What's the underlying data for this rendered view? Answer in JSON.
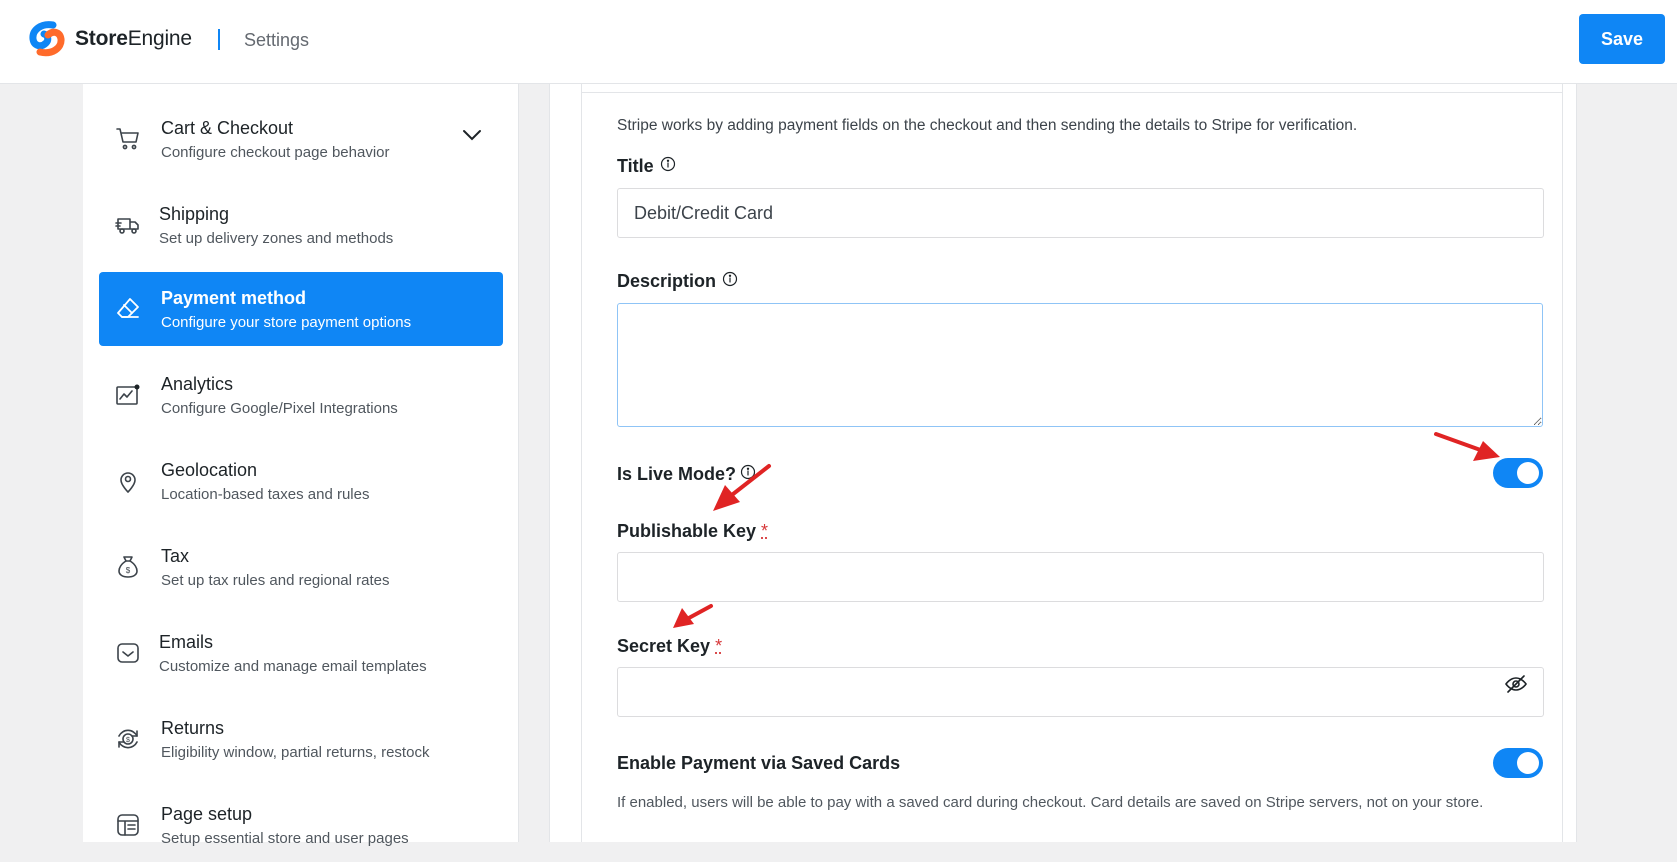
{
  "header": {
    "brand_bold": "Store",
    "brand_light": "Engine",
    "section": "Settings",
    "save_label": "Save"
  },
  "sidebar": {
    "items": [
      {
        "label": "Cart & Checkout",
        "desc": "Configure checkout page behavior",
        "icon": "cart-icon"
      },
      {
        "label": "Shipping",
        "desc": "Set up delivery zones and methods",
        "icon": "truck-icon"
      },
      {
        "label": "Payment method",
        "desc": "Configure your store payment options",
        "icon": "eraser-icon"
      },
      {
        "label": "Analytics",
        "desc": "Configure Google/Pixel Integrations",
        "icon": "chart-icon"
      },
      {
        "label": "Geolocation",
        "desc": "Location-based taxes and rules",
        "icon": "map-pin-icon"
      },
      {
        "label": "Tax",
        "desc": "Set up tax rules and regional rates",
        "icon": "money-bag-icon"
      },
      {
        "label": "Emails",
        "desc": "Customize and manage email templates",
        "icon": "mail-icon"
      },
      {
        "label": "Returns",
        "desc": "Eligibility window, partial returns, restock",
        "icon": "refund-icon"
      },
      {
        "label": "Page setup",
        "desc": "Setup essential store and user pages",
        "icon": "layout-icon"
      }
    ]
  },
  "form": {
    "intro": "Stripe works by adding payment fields on the checkout and then sending the details to Stripe for verification.",
    "title_label": "Title",
    "title_value": "Debit/Credit Card",
    "description_label": "Description",
    "description_value": "",
    "live_mode_label": "Is Live Mode?",
    "live_mode_on": true,
    "publishable_key_label": "Publishable Key",
    "publishable_key_value": "",
    "secret_key_label": "Secret Key",
    "secret_key_value": "",
    "required_mark": "*",
    "saved_cards_label": "Enable Payment via Saved Cards",
    "saved_cards_on": true,
    "saved_cards_help": "If enabled, users will be able to pay with a saved card during checkout. Card details are saved on Stripe servers, not on your store."
  },
  "colors": {
    "accent": "#0f86f5",
    "annotation_arrow": "#e02424",
    "required": "#d63638"
  }
}
